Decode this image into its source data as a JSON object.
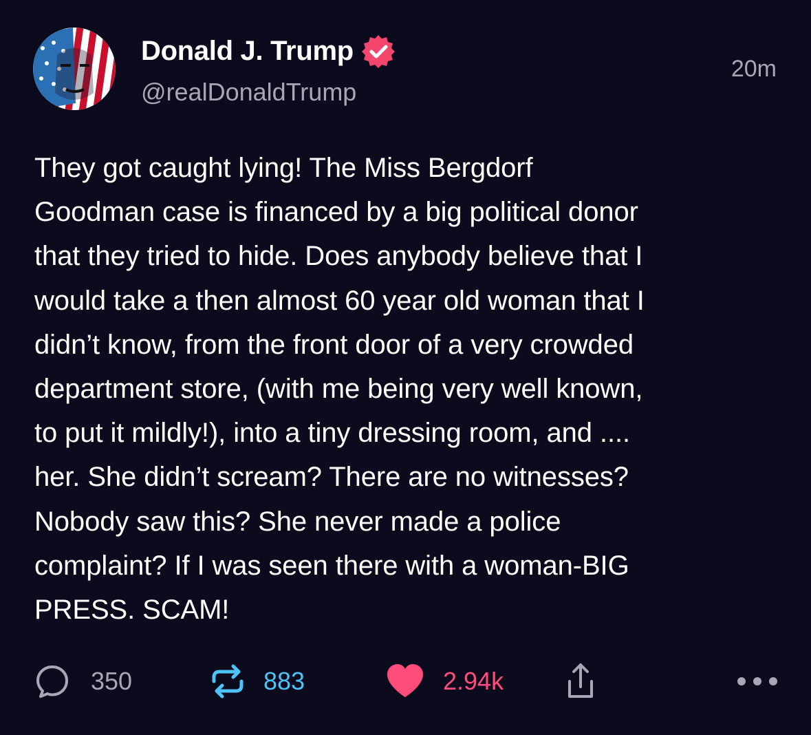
{
  "post": {
    "author": {
      "display_name": "Donald J. Trump",
      "handle": "@realDonaldTrump",
      "verified": true
    },
    "timestamp": "20m",
    "body_lines": [
      "They got caught lying! The Miss Bergdorf",
      "Goodman case is financed by a big political donor",
      "that they tried to hide. Does anybody believe that I",
      "would take a then almost 60 year old woman that I",
      "didn’t know, from the front door of a very crowded",
      "department store, (with me being very well known,",
      "to put it mildly!), into a tiny dressing room, and ....",
      "her. She didn’t scream? There are no witnesses?",
      "Nobody saw this? She never made a police",
      "complaint? If I was seen there with a woman-BIG",
      "PRESS. SCAM!"
    ]
  },
  "actions": {
    "replies": {
      "icon": "reply-bubble-icon",
      "count": "350"
    },
    "retruths": {
      "icon": "retruth-icon",
      "count": "883"
    },
    "likes": {
      "icon": "heart-icon",
      "count": "2.94k"
    },
    "share": {
      "icon": "share-icon"
    },
    "more": {
      "icon": "more-dots-icon"
    }
  },
  "colors": {
    "background": "#0b0b1d",
    "text": "#ffffff",
    "muted": "#a7a8b6",
    "retruth": "#4ec3f7",
    "like": "#ff4d7a",
    "verified_badge": "#f4456d"
  }
}
